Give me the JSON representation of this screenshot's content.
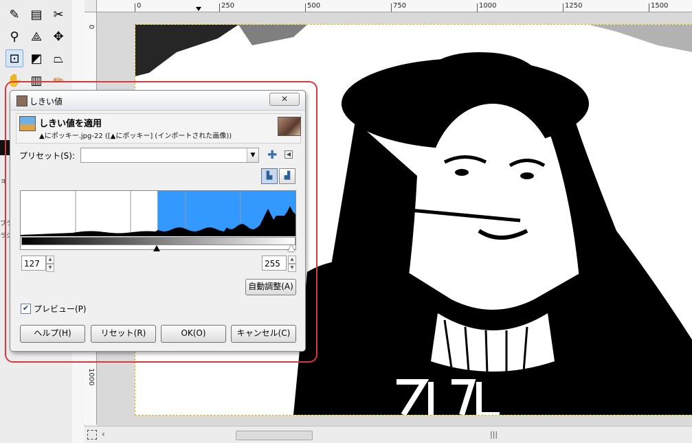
{
  "ruler": {
    "labels": [
      "0",
      "250",
      "500",
      "750",
      "1000",
      "1250",
      "1500"
    ],
    "left_labels": [
      "0",
      "1000"
    ]
  },
  "dialog": {
    "title": "しきい値",
    "close_glyph": "✕",
    "header_title": "しきい値を適用",
    "header_subtitle": "▲にポッキー.jpg-22 ([▲にポッキー] (インポートされた画像))",
    "preset_label": "プリセット(S):",
    "preset_value": "",
    "low_value": "127",
    "high_value": "255",
    "auto_button": "自動調整(A)",
    "preview_label": "プレビュー(P)",
    "preview_checked": true,
    "help_button": "ヘルプ(H)",
    "reset_button": "リセット(R)",
    "ok_button": "OK(O)",
    "cancel_button": "キャンセル(C)"
  },
  "left_panel_text": [
    "ョ",
    "プラ",
    "ラシ"
  ],
  "colors": {
    "selection": "#3399ff",
    "annotation": "#d9373c"
  },
  "histogram": {
    "threshold_low": 127,
    "threshold_high": 255,
    "range_max": 255
  }
}
